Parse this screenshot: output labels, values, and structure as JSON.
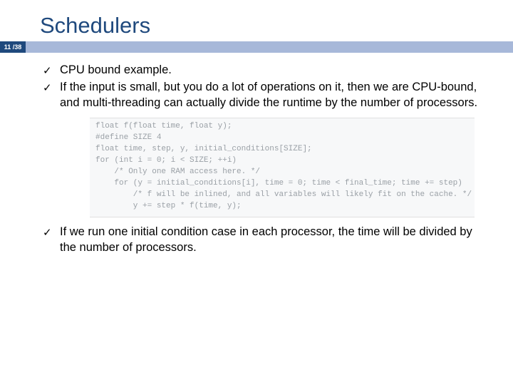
{
  "slide": {
    "title": "Schedulers",
    "page_indicator": "11 /38",
    "bullets_top": [
      "CPU bound example.",
      "If the input is small, but you do a lot of operations on it, then we are CPU-bound, and multi-threading can actually divide the runtime by the number of processors."
    ],
    "code": "float f(float time, float y);\n#define SIZE 4\nfloat time, step, y, initial_conditions[SIZE];\nfor (int i = 0; i < SIZE; ++i)\n    /* Only one RAM access here. */\n    for (y = initial_conditions[i], time = 0; time < final_time; time += step)\n        /* f will be inlined, and all variables will likely fit on the cache. */\n        y += step * f(time, y);",
    "bullets_bottom": [
      "If we run one initial condition case in each processor, the time will be divided by the number of processors."
    ]
  }
}
